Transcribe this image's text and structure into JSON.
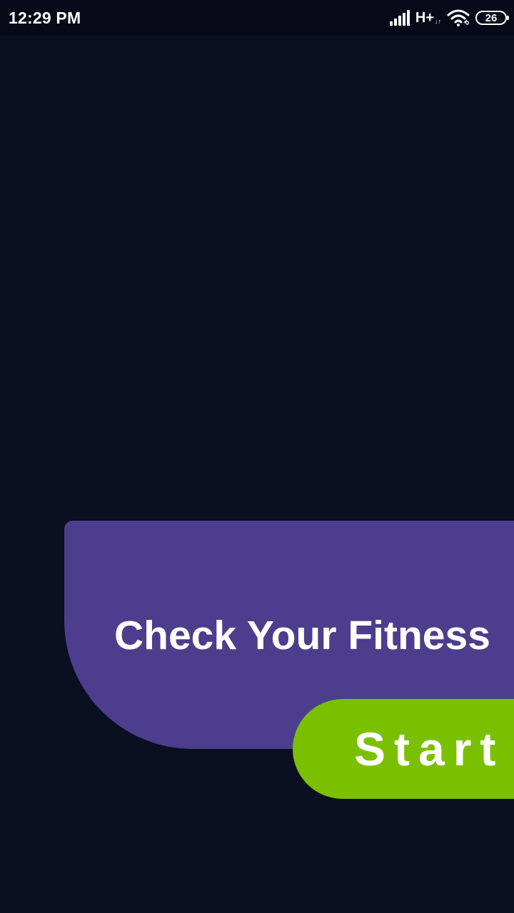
{
  "status_bar": {
    "time": "12:29 PM",
    "network_type": "H+",
    "network_arrows": "↓↑",
    "battery_level": "26",
    "icons": [
      "signal-icon",
      "wifi-icon",
      "battery-icon"
    ]
  },
  "card": {
    "title": "Check Your Fitness"
  },
  "start_button": {
    "label": "Start"
  },
  "colors": {
    "background": "#0a0f21",
    "status_bar": "#060a18",
    "card": "#4c3e8c",
    "button": "#7bc000",
    "text": "#ffffff"
  }
}
